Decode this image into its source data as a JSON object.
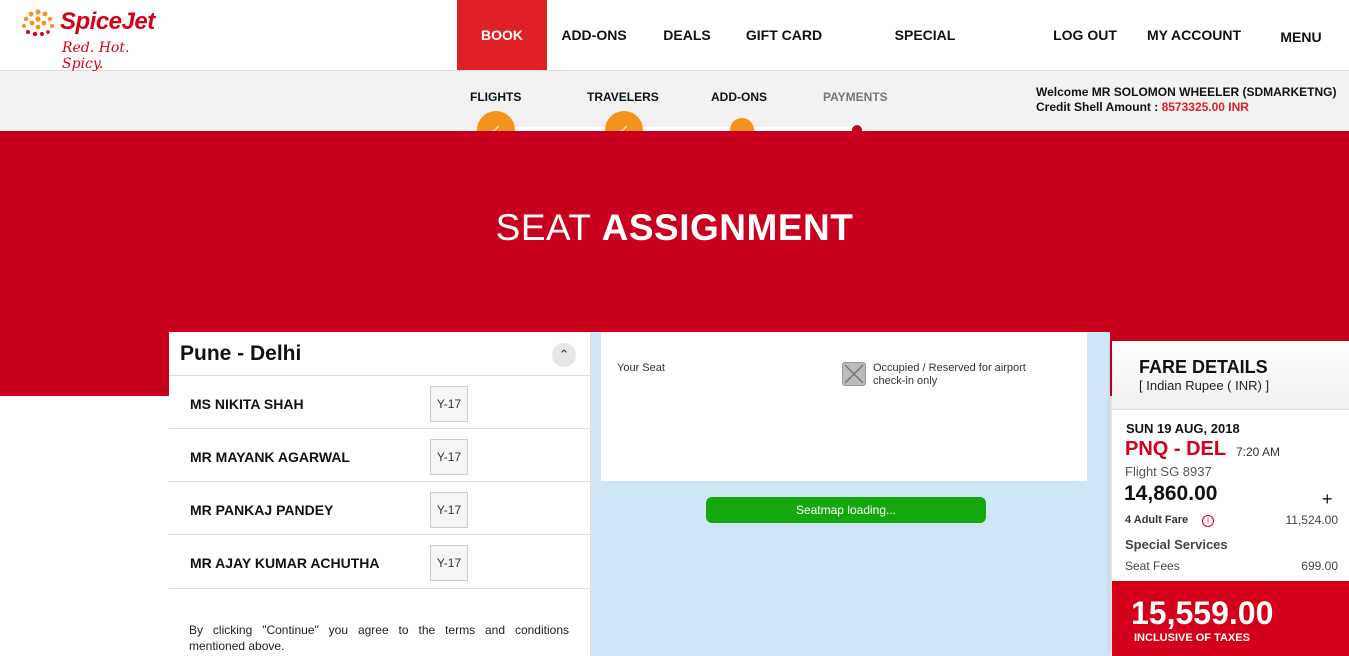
{
  "brand": {
    "name": "SpiceJet",
    "tagline": "Red. Hot. Spicy."
  },
  "nav": {
    "items": [
      "BOOK",
      "ADD-ONS",
      "DEALS",
      "GIFT CARD",
      "SPECIAL ASSISTANCE",
      "LOG OUT",
      "MY ACCOUNT",
      "MENU"
    ],
    "active": "BOOK"
  },
  "steps": [
    {
      "label": "FLIGHTS",
      "state": "done"
    },
    {
      "label": "TRAVELERS",
      "state": "done"
    },
    {
      "label": "ADD-ONS",
      "state": "current"
    },
    {
      "label": "PAYMENTS",
      "state": "upcoming"
    }
  ],
  "user": {
    "welcome": "Welcome MR SOLOMON WHEELER (SDMARKETNG)",
    "credit_label": "Credit Shell Amount :",
    "credit_value": "8573325.00 INR"
  },
  "hero": {
    "title_light": "SEAT",
    "title_bold": "ASSIGNMENT"
  },
  "route": {
    "title": "Pune - Delhi"
  },
  "passengers": [
    {
      "name": "MS NIKITA SHAH",
      "seat": "Y-17"
    },
    {
      "name": "MR MAYANK AGARWAL",
      "seat": "Y-17"
    },
    {
      "name": "MR PANKAJ PANDEY",
      "seat": "Y-17"
    },
    {
      "name": "MR AJAY KUMAR ACHUTHA",
      "seat": "Y-17"
    }
  ],
  "terms": "By clicking \"Continue\" you agree to the terms and conditions mentioned above.",
  "seatmap": {
    "legend_your_seat": "Your Seat",
    "legend_occupied": "Occupied / Reserved for airport check-in only",
    "loading": "Seatmap loading..."
  },
  "fare": {
    "title": "FARE DETAILS",
    "currency": "[ Indian Rupee ( INR) ]",
    "date": "SUN 19 AUG, 2018",
    "route": "PNQ - DEL",
    "time": "7:20 AM",
    "flight": "Flight SG 8937",
    "base_total": "14,860.00",
    "adult_label": "4  Adult Fare",
    "adult_value": "11,524.00",
    "special_services": "Special Services",
    "seat_fees_label": "Seat Fees",
    "seat_fees_value": "699.00",
    "grand_total": "15,559.00",
    "total_note": "INCLUSIVE OF TAXES"
  },
  "colors": {
    "brand_red": "#c8001e",
    "accent_orange": "#f5921e",
    "loading_green": "#14a80d",
    "seatmap_bg": "#cfe6f7"
  }
}
